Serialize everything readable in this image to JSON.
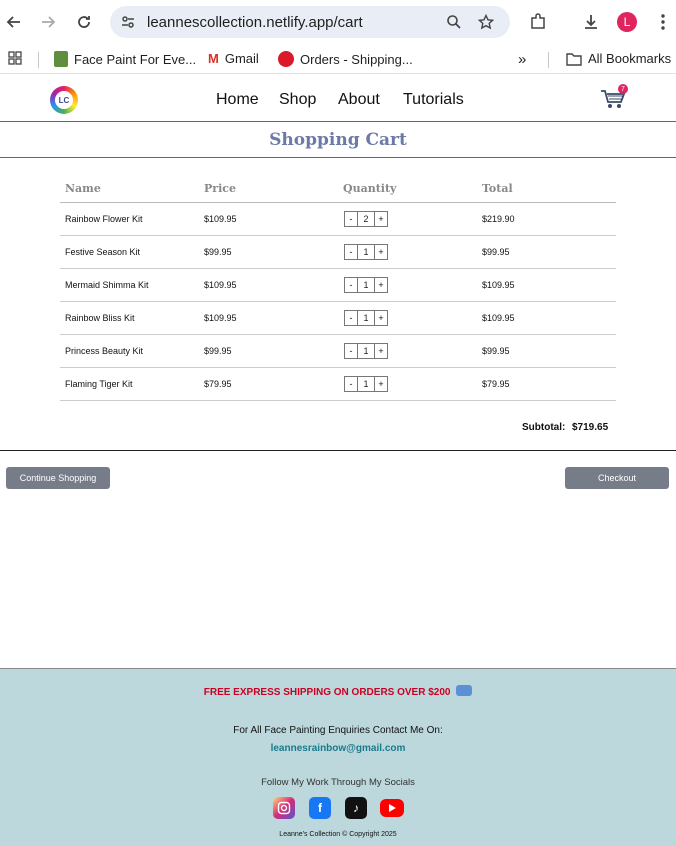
{
  "browser": {
    "url": "leannescollection.netlify.app/cart",
    "avatar_letter": "L",
    "bookmarks": [
      "Face Paint For Eve...",
      "Gmail",
      "Orders - Shipping...",
      "All Bookmarks"
    ]
  },
  "site": {
    "logo_text": "LC",
    "nav": [
      "Home",
      "Shop",
      "About",
      "Tutorials"
    ],
    "cart_count": "7"
  },
  "cart": {
    "title": "Shopping Cart",
    "columns": [
      "Name",
      "Price",
      "Quantity",
      "Total"
    ],
    "rows": [
      {
        "name": "Rainbow Flower Kit",
        "price": "$109.95",
        "qty": "2",
        "total": "$219.90"
      },
      {
        "name": "Festive Season Kit",
        "price": "$99.95",
        "qty": "1",
        "total": "$99.95"
      },
      {
        "name": "Mermaid Shimma Kit",
        "price": "$109.95",
        "qty": "1",
        "total": "$109.95"
      },
      {
        "name": "Rainbow Bliss Kit",
        "price": "$109.95",
        "qty": "1",
        "total": "$109.95"
      },
      {
        "name": "Princess Beauty Kit",
        "price": "$99.95",
        "qty": "1",
        "total": "$99.95"
      },
      {
        "name": "Flaming Tiger Kit",
        "price": "$79.95",
        "qty": "1",
        "total": "$79.95"
      }
    ],
    "minus": "-",
    "plus": "+",
    "subtotal_label": "Subtotal:",
    "subtotal_value": "$719.65",
    "continue_label": "Continue Shopping",
    "checkout_label": "Checkout"
  },
  "footer": {
    "shipping": "FREE EXPRESS SHIPPING ON ORDERS OVER $200",
    "enquiries": "For All Face Painting Enquiries Contact Me On:",
    "email": "leannesrainbow@gmail.com",
    "socials_heading": "Follow My Work Through My Socials",
    "copyright": "Leanne's Collection © Copyright 2025"
  },
  "colors": {
    "title": "#6b7aa8",
    "button": "#777c89",
    "footer_bg": "#bcd8dc",
    "shipping_text": "#cc0022",
    "email": "#1a7a8c"
  }
}
